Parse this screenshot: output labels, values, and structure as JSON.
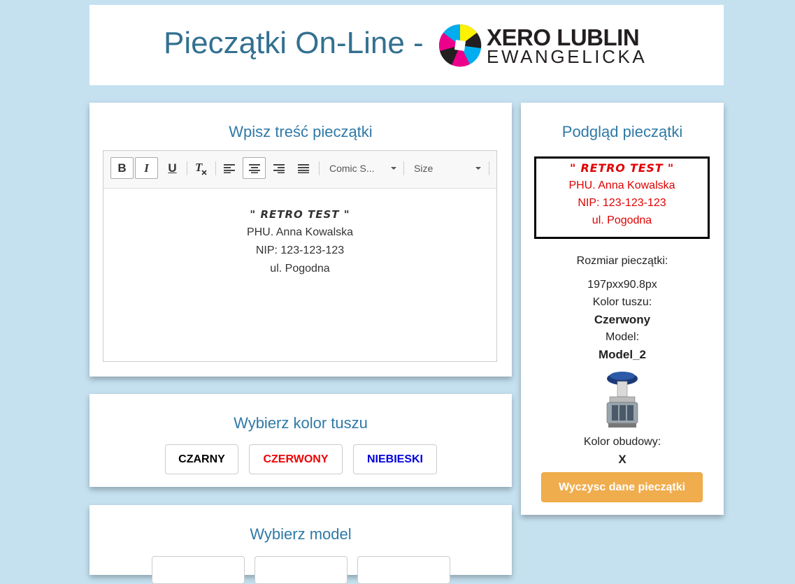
{
  "header": {
    "title": "Pieczątki On-Line -",
    "logo_line1": "XERO LUBLIN",
    "logo_line2": "EWANGELICKA"
  },
  "editor_panel": {
    "title": "Wpisz treść pieczątki",
    "toolbar": {
      "bold": "B",
      "italic": "I",
      "underline": "U",
      "clear_format": "Tx",
      "font_select": "Comic S...",
      "size_select": "Size"
    },
    "content": {
      "line1": "\" RETRO TEST \"",
      "line2": "PHU. Anna Kowalska",
      "line3": "NIP: 123-123-123",
      "line4": "ul. Pogodna"
    }
  },
  "ink_panel": {
    "title": "Wybierz kolor tuszu",
    "buttons": [
      {
        "label": "CZARNY",
        "color": "#000000"
      },
      {
        "label": "CZERWONY",
        "color": "#ee0000"
      },
      {
        "label": "NIEBIESKI",
        "color": "#0000dd"
      }
    ]
  },
  "model_panel": {
    "title": "Wybierz model"
  },
  "preview_panel": {
    "title": "Podgląd pieczątki",
    "stamp": {
      "line1": "\" RETRO TEST \"",
      "line2": "PHU. Anna Kowalska",
      "line3": "NIP: 123-123-123",
      "line4": "ul. Pogodna",
      "ink_color": "#e00000"
    },
    "size_label": "Rozmiar pieczątki:",
    "size_value": "197pxx90.8px",
    "ink_label": "Kolor tuszu:",
    "ink_value": "Czerwony",
    "model_label": "Model:",
    "model_value": "Model_2",
    "body_color_label": "Kolor obudowy:",
    "body_color_value": "X",
    "clear_button": "Wyczysc dane pieczątki"
  },
  "colors": {
    "background": "#c5e1f0",
    "accent": "#2f79a6",
    "button_warning": "#f0ad4e"
  }
}
